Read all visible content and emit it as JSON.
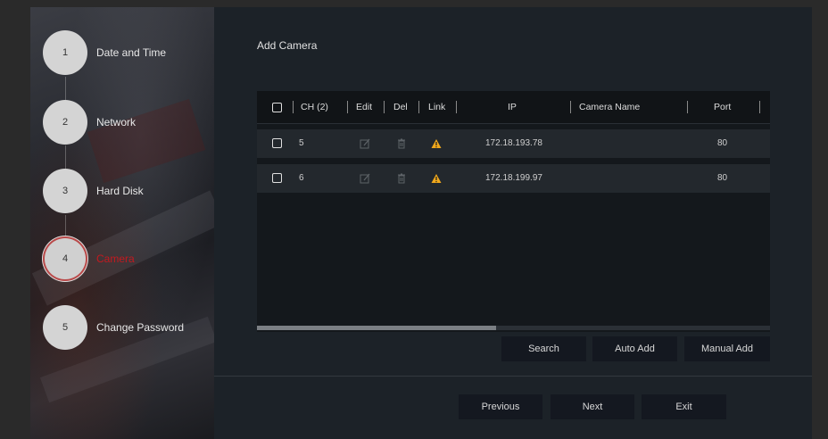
{
  "wizard": {
    "steps": [
      {
        "number": "1",
        "label": "Date and Time"
      },
      {
        "number": "2",
        "label": "Network"
      },
      {
        "number": "3",
        "label": "Hard Disk"
      },
      {
        "number": "4",
        "label": "Camera"
      },
      {
        "number": "5",
        "label": "Change Password"
      }
    ],
    "active_step": 4
  },
  "page": {
    "title": "Add Camera"
  },
  "table": {
    "headers": {
      "ch": "CH (2)",
      "edit": "Edit",
      "del": "Del",
      "link": "Link",
      "ip": "IP",
      "camera_name": "Camera Name",
      "port": "Port"
    },
    "rows": [
      {
        "ch": "5",
        "ip": "172.18.193.78",
        "camera_name": "",
        "port": "80",
        "link_status": "warning-icon"
      },
      {
        "ch": "6",
        "ip": "172.18.199.97",
        "camera_name": "",
        "port": "80",
        "link_status": "warning-icon"
      }
    ]
  },
  "actions": {
    "search": "Search",
    "auto_add": "Auto Add",
    "manual_add": "Manual Add"
  },
  "footer": {
    "previous": "Previous",
    "next": "Next",
    "exit": "Exit"
  },
  "colors": {
    "active_step": "#c4191f",
    "warning": "#f0a81c",
    "panel": "#1c2228"
  }
}
